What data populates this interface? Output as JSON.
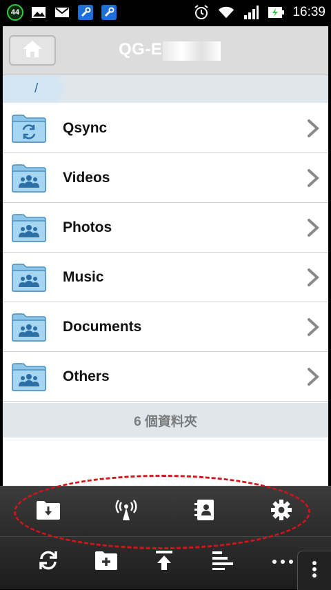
{
  "status_bar": {
    "badge_count": "44",
    "time": "16:39",
    "icons": [
      "image-icon",
      "gmail-icon",
      "wrench-icon",
      "wrench-icon",
      "alarm-icon",
      "wifi-icon",
      "signal-icon",
      "battery-charging-icon"
    ]
  },
  "header": {
    "title": "QG-E",
    "home_icon": "home-icon"
  },
  "breadcrumb": {
    "path": "/"
  },
  "folders": [
    {
      "label": "Qsync",
      "icon": "sync-folder-icon"
    },
    {
      "label": "Videos",
      "icon": "shared-folder-icon"
    },
    {
      "label": "Photos",
      "icon": "shared-folder-icon"
    },
    {
      "label": "Music",
      "icon": "shared-folder-icon"
    },
    {
      "label": "Documents",
      "icon": "shared-folder-icon"
    },
    {
      "label": "Others",
      "icon": "shared-folder-icon"
    }
  ],
  "summary": "6 個資料夾",
  "toolbar_top": [
    "download-folder-icon",
    "broadcast-icon",
    "contacts-icon",
    "settings-icon"
  ],
  "toolbar_bottom": [
    "refresh-icon",
    "new-folder-icon",
    "upload-icon",
    "sort-icon",
    "more-icon",
    "menu-icon"
  ],
  "colors": {
    "accent": "#2866a8",
    "highlight": "#d4141b",
    "folder": "#8ec6ea"
  }
}
